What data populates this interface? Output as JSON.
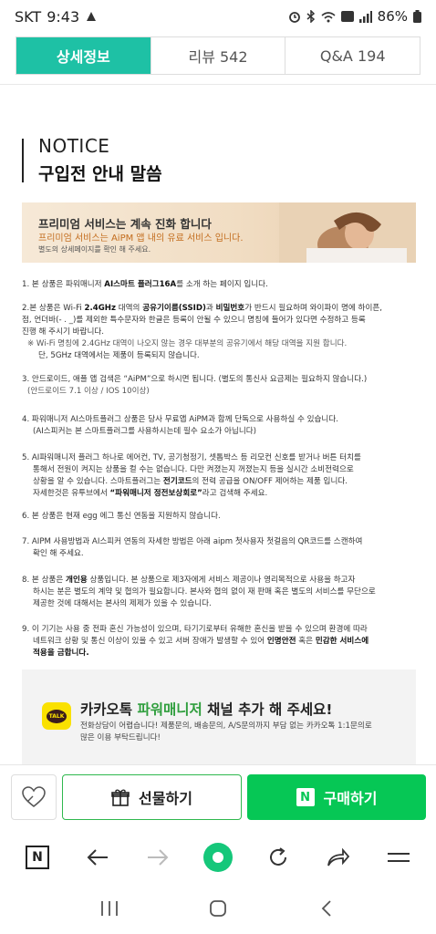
{
  "status_bar": {
    "carrier": "SKT",
    "time": "9:43",
    "battery": "86%"
  },
  "tabs": [
    {
      "label": "상세정보",
      "active": true
    },
    {
      "label": "리뷰 542",
      "active": false
    },
    {
      "label": "Q&A 194",
      "active": false
    }
  ],
  "notice": {
    "title": "NOTICE",
    "subtitle": "구입전 안내 말씀"
  },
  "banner": {
    "headline": "프리미엄 서비스는 계속 진화 합니다",
    "sub": "프리미엄 서비스는 AiPM 앱 내의 유료 서비스 입니다.",
    "note": "별도의 상세페이지를 확인 해 주세요."
  },
  "items": {
    "i1": {
      "a": "1. 본 상품은 파워매니저 ",
      "b": "AI스마트 플러그16A",
      "c": "를 소개 하는 페이지 입니다."
    },
    "i2": {
      "l1a": "2.본 상품은 Wi-Fi ",
      "l1b": "2.4GHz",
      "l1c": " 대역의 ",
      "l1d": "공유기이름(SSID)",
      "l1e": "과 ",
      "l1f": "비밀번호",
      "l1g": "가 반드시 필요하며 와이파이 명에 하이픈,",
      "l2": "점, 언더바(- . _)를 제외한 특수문자와 한글은 등록이 안될 수 있으니 명칭에 들어가 있다면 수정하고 등록",
      "l3": "진행 해 주시기 바랍니다.",
      "l4": "※ Wi-Fi 명칭에 2.4GHz 대역이 나오지 않는 경우 대부분의 공유기에서 해당 대역을 지원 합니다.",
      "l5": "단, 5GHz 대역에서는 제품이 등록되지 않습니다."
    },
    "i3": {
      "l1": "3. 안드로이드, 애플 앱 검색은 “AiPM”으로 하시면 됩니다. (별도의 통신사 요금제는 필요하지 않습니다.)",
      "l2": "(안드로이드 7.1 이상 / IOS 10이상)"
    },
    "i4": {
      "l1": "4. 파워매니저 AI스마트플러그 상품은 당사 무료앱 AiPM과 함께 단독으로 사용하실 수 있습니다.",
      "l2": "(AI스피커는 본 스마트플러그를 사용하시는데 필수 요소가 아닙니다)"
    },
    "i5": {
      "l1": "5. AI파워매니저 플러그 하나로 에어컨, TV,  공기청정기, 셋톱박스 등 리모컨 신호를 받거나 버튼 터치를",
      "l2": "통해서 전원이 켜지는 상품을 컬 수는 없습니다. 다만 켜졌는지 꺼졌는지 등을 실시간 소비전력으로",
      "l3a": "상황을 알 수 있습니다. 스마트플러그는 ",
      "l3b": "전기코드",
      "l3c": "의 전력 공급을 ON/OFF 제어하는 제품 입니다.",
      "l4a": "자세한것은 유투브에서 ",
      "l4b": "“파워매니저 정전보상회로”",
      "l4c": "라고 검색해 주세요."
    },
    "i6": {
      "l1": "6. 본 상품은 현재 egg 에그 통신 연동을 지원하지 않습니다."
    },
    "i7": {
      "l1": "7. AIPM 사용방법과 AI스피커 연동의 자세한 방법은 아래 aipm 첫사용자 첫걸음의 QR코드를  스캔하여",
      "l2": "확인 해 주세요."
    },
    "i8": {
      "l1a": "8. 본 상품은 ",
      "l1b": "개인용",
      "l1c": " 상품입니다. 본 상품으로 제3자에게 서비스 제공이나 영리목적으로 사용을 하고자",
      "l2": "하시는 분은  별도의 계약 및 협의가 필요합니다. 본사와 협의 없이 재 판매 혹은 별도의 서비스를 무단으로",
      "l3": "제공한 것에 대해서는  본사의 제제가 있을 수 있습니다."
    },
    "i9": {
      "l1": "9. 이 기기는 사용 중 전파 혼신 가능성이 있으며, 타기기로부터 유해한 혼신을 받을 수 있으며 환경에 따라",
      "l2a": "네트워크 상황 및 통신 이상이 있을 수 있고 서버 장애가 발생할 수 있어  ",
      "l2b": "인명안전",
      "l2c": " 혹은 ",
      "l2d": "민감한 서비스에",
      "l3": "적용을 금합니다."
    }
  },
  "kakao": {
    "logo_text": "TALK",
    "title_a": "카카오톡 ",
    "title_b": "파워매니저",
    "title_c": " 채널 추가 해 주세요!",
    "desc1": "전화상담이 어렵습니다! 제품문의, 배송문의, A/S문의까지 부담 없는 카카오톡 1:1문의로",
    "desc2": "많은 이용 부탁드립니다!"
  },
  "actions": {
    "gift": "선물하기",
    "buy": "구매하기",
    "buy_badge": "N"
  },
  "browser": {
    "home_label": "N"
  },
  "colors": {
    "tab_active": "#1ec1a5",
    "buy_green": "#06c755",
    "kakao_yellow": "#fae100",
    "power_green": "#2f9e3d"
  }
}
